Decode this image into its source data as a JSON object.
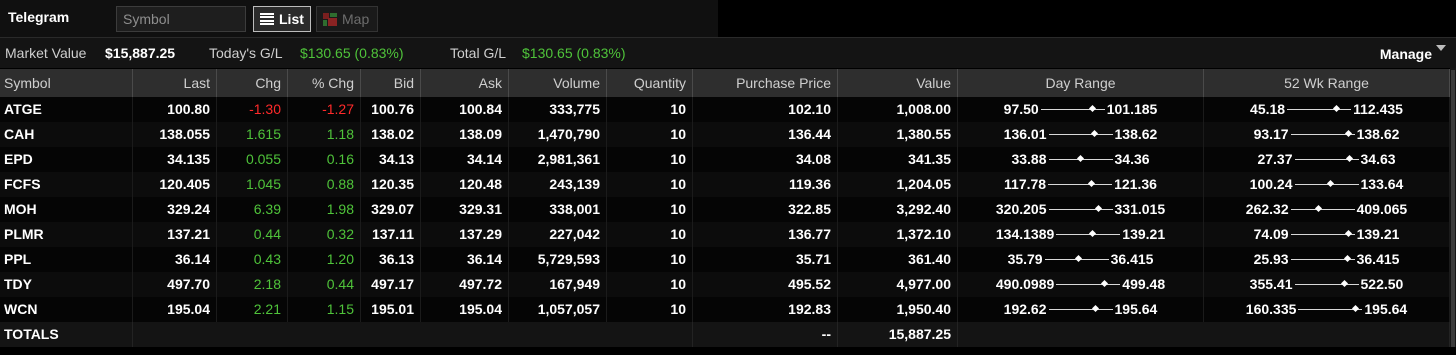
{
  "toolbar": {
    "title": "Telegram",
    "symbol_placeholder": "Symbol",
    "list_label": "List",
    "map_label": "Map"
  },
  "summary": {
    "market_value_label": "Market Value",
    "market_value": "$15,887.25",
    "todays_gl_label": "Today's G/L",
    "todays_gl": "$130.65 (0.83%)",
    "total_gl_label": "Total G/L",
    "total_gl": "$130.65 (0.83%)",
    "manage_label": "Manage"
  },
  "columns": [
    "Symbol",
    "Last",
    "Chg",
    "% Chg",
    "Bid",
    "Ask",
    "Volume",
    "Quantity",
    "Purchase Price",
    "Value",
    "Day Range",
    "52 Wk Range"
  ],
  "rows": [
    {
      "symbol": "ATGE",
      "last": "100.80",
      "chg": "-1.30",
      "pct": "-1.27",
      "bid": "100.76",
      "ask": "100.84",
      "volume": "333,775",
      "qty": "10",
      "purchase": "102.10",
      "value": "1,008.00",
      "day_lo": "97.50",
      "day_hi": "101.185",
      "day_pos": 0.88,
      "wk_lo": "45.18",
      "wk_hi": "112.435",
      "wk_pos": 0.83
    },
    {
      "symbol": "CAH",
      "last": "138.055",
      "chg": "1.615",
      "pct": "1.18",
      "bid": "138.02",
      "ask": "138.09",
      "volume": "1,470,790",
      "qty": "10",
      "purchase": "136.44",
      "value": "1,380.55",
      "day_lo": "136.01",
      "day_hi": "138.62",
      "day_pos": 0.78,
      "wk_lo": "93.17",
      "wk_hi": "138.62",
      "wk_pos": 0.99
    },
    {
      "symbol": "EPD",
      "last": "34.135",
      "chg": "0.055",
      "pct": "0.16",
      "bid": "34.13",
      "ask": "34.14",
      "volume": "2,981,361",
      "qty": "10",
      "purchase": "34.08",
      "value": "341.35",
      "day_lo": "33.88",
      "day_hi": "34.36",
      "day_pos": 0.53,
      "wk_lo": "27.37",
      "wk_hi": "34.63",
      "wk_pos": 0.93
    },
    {
      "symbol": "FCFS",
      "last": "120.405",
      "chg": "1.045",
      "pct": "0.88",
      "bid": "120.35",
      "ask": "120.48",
      "volume": "243,139",
      "qty": "10",
      "purchase": "119.36",
      "value": "1,204.05",
      "day_lo": "117.78",
      "day_hi": "121.36",
      "day_pos": 0.73,
      "wk_lo": "100.24",
      "wk_hi": "133.64",
      "wk_pos": 0.6
    },
    {
      "symbol": "MOH",
      "last": "329.24",
      "chg": "6.39",
      "pct": "1.98",
      "bid": "329.07",
      "ask": "329.31",
      "volume": "338,001",
      "qty": "10",
      "purchase": "322.85",
      "value": "3,292.40",
      "day_lo": "320.205",
      "day_hi": "331.015",
      "day_pos": 0.84,
      "wk_lo": "262.32",
      "wk_hi": "409.065",
      "wk_pos": 0.45
    },
    {
      "symbol": "PLMR",
      "last": "137.21",
      "chg": "0.44",
      "pct": "0.32",
      "bid": "137.11",
      "ask": "137.29",
      "volume": "227,042",
      "qty": "10",
      "purchase": "136.77",
      "value": "1,372.10",
      "day_lo": "134.1389",
      "day_hi": "139.21",
      "day_pos": 0.6,
      "wk_lo": "74.09",
      "wk_hi": "139.21",
      "wk_pos": 0.99
    },
    {
      "symbol": "PPL",
      "last": "36.14",
      "chg": "0.43",
      "pct": "1.20",
      "bid": "36.13",
      "ask": "36.14",
      "volume": "5,729,593",
      "qty": "10",
      "purchase": "35.71",
      "value": "361.40",
      "day_lo": "35.79",
      "day_hi": "36.415",
      "day_pos": 0.56,
      "wk_lo": "25.93",
      "wk_hi": "36.415",
      "wk_pos": 0.97
    },
    {
      "symbol": "TDY",
      "last": "497.70",
      "chg": "2.18",
      "pct": "0.44",
      "bid": "497.17",
      "ask": "497.72",
      "volume": "167,949",
      "qty": "10",
      "purchase": "495.52",
      "value": "4,977.00",
      "day_lo": "490.0989",
      "day_hi": "499.48",
      "day_pos": 0.81,
      "wk_lo": "355.41",
      "wk_hi": "522.50",
      "wk_pos": 0.85
    },
    {
      "symbol": "WCN",
      "last": "195.04",
      "chg": "2.21",
      "pct": "1.15",
      "bid": "195.01",
      "ask": "195.04",
      "volume": "1,057,057",
      "qty": "10",
      "purchase": "192.83",
      "value": "1,950.40",
      "day_lo": "192.62",
      "day_hi": "195.64",
      "day_pos": 0.8,
      "wk_lo": "160.335",
      "wk_hi": "195.64",
      "wk_pos": 0.98
    }
  ],
  "totals": {
    "label": "TOTALS",
    "purchase": "--",
    "value": "15,887.25"
  },
  "colors": {
    "positive": "#4fc33a",
    "negative": "#ff2a2a",
    "header_bg": "#2e2e2e"
  }
}
